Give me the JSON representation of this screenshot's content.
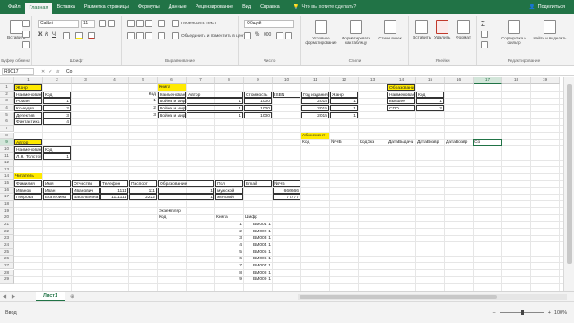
{
  "tabs": [
    "Файл",
    "Главная",
    "Вставка",
    "Разметка страницы",
    "Формулы",
    "Данные",
    "Рецензирование",
    "Вид",
    "Справка"
  ],
  "active_tab": "Главная",
  "tell_me": "Что вы хотите сделать?",
  "share": "Поделиться",
  "ribbon": {
    "clipboard": {
      "label": "Буфер обмена",
      "paste": "Вставить"
    },
    "font": {
      "label": "Шрифт",
      "name": "Calibri",
      "size": "11"
    },
    "alignment": {
      "label": "Выравнивание",
      "wrap": "Переносить текст",
      "merge": "Объединить и поместить в центре"
    },
    "number": {
      "label": "Число",
      "format": "Общий"
    },
    "styles": {
      "label": "Стили",
      "conditional": "Условное форматирование",
      "as_table": "Форматировать как таблицу",
      "cell_styles": "Стили ячеек"
    },
    "cells": {
      "label": "Ячейки",
      "insert": "Вставить",
      "delete": "Удалить",
      "format": "Формат"
    },
    "editing": {
      "label": "Редактирование",
      "sort": "Сортировка и фильтр",
      "find": "Найти и выделить"
    }
  },
  "formula_bar": {
    "name_box": "R9C17",
    "value": "Со"
  },
  "columns": [
    "1",
    "2",
    "3",
    "4",
    "5",
    "6",
    "7",
    "8",
    "9",
    "10",
    "11",
    "12",
    "13",
    "14",
    "15",
    "16",
    "17",
    "18",
    "19"
  ],
  "rows": [
    "1",
    "2",
    "3",
    "4",
    "5",
    "6",
    "7",
    "8",
    "9",
    "10",
    "11",
    "12",
    "13",
    "14",
    "15",
    "16",
    "17",
    "18",
    "19",
    "20",
    "21",
    "22",
    "23",
    "24",
    "25",
    "26",
    "27",
    "28",
    "29"
  ],
  "cells": {
    "zhanr_title": "Жанр",
    "zh_h1": "Наименование",
    "zh_h2": "Код",
    "zh_r1": "Роман",
    "zh_r1c": "1",
    "zh_r2": "Комедия",
    "zh_r2c": "2",
    "zh_r3": "Детектив",
    "zh_r3c": "3",
    "zh_r4": "Фантастика",
    "zh_r4c": "4",
    "book_code_h": "Код",
    "kniga_title": "Книга",
    "kn_h1": "Наименование",
    "kn_h2": "Автор",
    "kn_h3": "Стоимость",
    "kn_h4": "ISBN",
    "kn_h5": "Год издания",
    "kn_h6": "Жанр",
    "kn_c1": "1",
    "kn_n1": "Война и мир т.1",
    "kn_a1": "1",
    "kn_s1": "1000",
    "kn_y1": "2015",
    "kn_g1": "1",
    "kn_c2": "2",
    "kn_n2": "Война и мир т.2",
    "kn_a2": "1",
    "kn_s2": "1000",
    "kn_y2": "2015",
    "kn_g2": "1",
    "kn_c3": "3",
    "kn_n3": "Война и мир т.3",
    "kn_a3": "1",
    "kn_s3": "1000",
    "kn_y3": "2015",
    "kn_g3": "1",
    "obr_title": "Образование",
    "ob_h1": "Наименование",
    "ob_h2": "Код",
    "ob_r1": "высшее",
    "ob_r1c": "1",
    "ob_r2": "СПО",
    "ob_r2c": "2",
    "avtor_title": "Автор",
    "av_h1": "Наименование",
    "av_h2": "Код",
    "av_r1": "Л.Н. Толстой",
    "av_r1c": "1",
    "abon_title": "Абонемент",
    "ab_h1": "Код",
    "ab_h2": "№ЧБ",
    "ab_h3": "КодЭкз",
    "ab_h4": "ДатаВыдачи",
    "ab_h5": "ДатаВозвр",
    "ab_h6": "ДатаВозвр",
    "ab_h7": "Со",
    "chit_title": "Читатель",
    "ch_h1": "Фамилия",
    "ch_h2": "Имя",
    "ch_h3": "Отчество",
    "ch_h4": "Телефон",
    "ch_h5": "Паспорт",
    "ch_h6": "Образование",
    "ch_h7": "Пол",
    "ch_h8": "Email",
    "ch_h9": "№ЧБ",
    "ch_r1_1": "Иванов",
    "ch_r1_2": "Иван",
    "ch_r1_3": "Иванович",
    "ch_r1_4": "1111",
    "ch_r1_5": "111",
    "ch_r1_6": "1",
    "ch_r1_7": "мужской",
    "ch_r1_9": "666666",
    "ch_r2_1": "Петрова",
    "ch_r2_2": "Екатерина",
    "ch_r2_3": "Васильевна",
    "ch_r2_4": "1111111",
    "ch_r2_5": "2222",
    "ch_r2_6": "1",
    "ch_r2_7": "женский",
    "ch_r2_9": "77777",
    "ekz_title": "Экземпляр",
    "ek_h1": "Код",
    "ek_h2": "Книга",
    "ek_h3": "Шифр",
    "ek_rows": [
      {
        "code": "1",
        "book": "1",
        "shifr": "BM001"
      },
      {
        "code": "2",
        "book": "1",
        "shifr": "BM002"
      },
      {
        "code": "3",
        "book": "1",
        "shifr": "BM003"
      },
      {
        "code": "4",
        "book": "1",
        "shifr": "BM004"
      },
      {
        "code": "5",
        "book": "1",
        "shifr": "BM005"
      },
      {
        "code": "6",
        "book": "1",
        "shifr": "BM006"
      },
      {
        "code": "7",
        "book": "1",
        "shifr": "BM007"
      },
      {
        "code": "8",
        "book": "1",
        "shifr": "BM008"
      },
      {
        "code": "9",
        "book": "1",
        "shifr": "BM009"
      }
    ]
  },
  "sheet_tab": "Лист1",
  "status": "Ввод",
  "zoom": "100%",
  "colors": {
    "excel_green": "#217346",
    "highlight": "#ffea00"
  }
}
